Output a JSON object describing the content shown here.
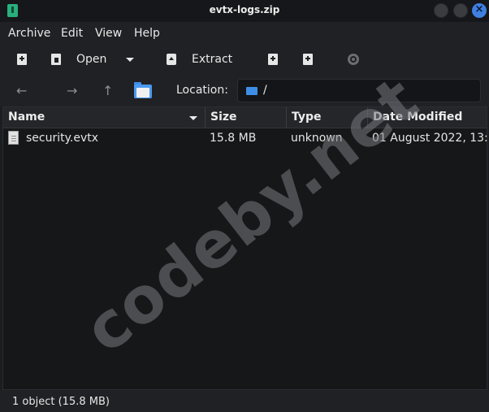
{
  "window": {
    "title": "evtx-logs.zip",
    "close_glyph": "×"
  },
  "menubar": {
    "items": [
      "Archive",
      "Edit",
      "View",
      "Help"
    ]
  },
  "toolbar": {
    "open_label": "Open",
    "extract_label": "Extract"
  },
  "location": {
    "label": "Location:",
    "path": "/"
  },
  "table": {
    "columns": [
      "Name",
      "Size",
      "Type",
      "Date Modified"
    ],
    "rows": [
      {
        "name": "security.evtx",
        "size": "15.8 MB",
        "type": "unknown",
        "modified": "01 August 2022, 13:..."
      }
    ]
  },
  "status": {
    "text": "1 object (15.8 MB)"
  },
  "watermark": {
    "text": "codeby.net"
  },
  "colors": {
    "accent": "#3f7fe0",
    "folder": "#4a9af0",
    "app_icon": "#29b07d"
  }
}
